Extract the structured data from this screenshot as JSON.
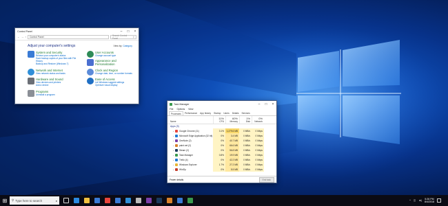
{
  "control_panel": {
    "title": "Control Panel",
    "address": "Control Panel",
    "search_placeholder": "Search Control Panel",
    "heading": "Adjust your computer's settings",
    "view_by_label": "View by:",
    "view_by_value": "Category",
    "categories": [
      {
        "title": "System and Security",
        "links": [
          "Review your computer's status",
          "Save backup copies of your files with File History",
          "Backup and Restore (Windows 7)"
        ],
        "color": "#3a7bd5"
      },
      {
        "title": "Network and Internet",
        "links": [
          "View network status and tasks"
        ],
        "color": "#2f8fd8"
      },
      {
        "title": "Hardware and Sound",
        "links": [
          "View devices and printers",
          "Add a device"
        ],
        "color": "#6b6f76"
      },
      {
        "title": "Programs",
        "links": [
          "Uninstall a program"
        ],
        "color": "#8b8f96"
      },
      {
        "title": "User Accounts",
        "links": [
          "Change account type"
        ],
        "color": "#2e8b57"
      },
      {
        "title": "Appearance and Personalization",
        "links": [],
        "color": "#4a6fd0"
      },
      {
        "title": "Clock and Region",
        "links": [
          "Change date, time, or number formats"
        ],
        "color": "#5b8bd9"
      },
      {
        "title": "Ease of Access",
        "links": [
          "Let Windows suggest settings",
          "Optimize visual display"
        ],
        "color": "#1f6fc4"
      }
    ]
  },
  "task_manager": {
    "title": "Task Manager",
    "menu": [
      "File",
      "Options",
      "View"
    ],
    "tabs": [
      "Processes",
      "Performance",
      "App history",
      "Startup",
      "Users",
      "Details",
      "Services"
    ],
    "columns": {
      "name": "Name",
      "cpu_pct": "11%",
      "cpu": "CPU",
      "mem_pct": "60%",
      "mem": "Memory",
      "disk_pct": "1%",
      "disk": "Disk",
      "net_pct": "0%",
      "net": "Network"
    },
    "group_label": "Apps (9)",
    "rows": [
      {
        "name": "Google Chrome (11)",
        "cpu": "3.1%",
        "mem": "1,279.6 MB",
        "disk": "0 MB/s",
        "net": "0 Mbps",
        "color": "#e8453c"
      },
      {
        "name": "Microsoft Edge Application (32 bit)",
        "cpu": "0%",
        "mem": "3.4 MB",
        "disk": "0 MB/s",
        "net": "0 Mbps",
        "color": "#1e7ad6"
      },
      {
        "name": "OneNote (2)",
        "cpu": "0%",
        "mem": "40.7 MB",
        "disk": "0 MB/s",
        "net": "0 Mbps",
        "color": "#7b3fa8"
      },
      {
        "name": "paint.net (2)",
        "cpu": "0%",
        "mem": "66.6 MB",
        "disk": "0 MB/s",
        "net": "0 Mbps",
        "color": "#d9822b"
      },
      {
        "name": "Steam (2)",
        "cpu": "0%",
        "mem": "56.8 MB",
        "disk": "0 MB/s",
        "net": "0 Mbps",
        "color": "#1b3a5c"
      },
      {
        "name": "Task Manager",
        "cpu": "0.8%",
        "mem": "19.9 MB",
        "disk": "0 MB/s",
        "net": "0 Mbps",
        "color": "#3a9a4e"
      },
      {
        "name": "Trello (4)",
        "cpu": "0%",
        "mem": "42.2 MB",
        "disk": "0 MB/s",
        "net": "0 Mbps",
        "color": "#1e7ad6"
      },
      {
        "name": "Windows Explorer",
        "cpu": "1.7%",
        "mem": "27.2 MB",
        "disk": "0 MB/s",
        "net": "0 Mbps",
        "color": "#e8b534"
      },
      {
        "name": "WinZip",
        "cpu": "0%",
        "mem": "5.5 MB",
        "disk": "0 MB/s",
        "net": "0 Mbps",
        "color": "#c43d2c"
      }
    ],
    "fewer_details": "Fewer details",
    "end_task": "End task"
  },
  "taskbar": {
    "search_placeholder": "Type here to search",
    "apps": [
      {
        "name": "task-view",
        "color": "#ffffff"
      },
      {
        "name": "edge",
        "color": "#2b8ae0"
      },
      {
        "name": "file-explorer",
        "color": "#f0c040"
      },
      {
        "name": "store",
        "color": "#3a7bd5"
      },
      {
        "name": "chrome",
        "color": "#e8453c"
      },
      {
        "name": "mail",
        "color": "#3a7bd5"
      },
      {
        "name": "photos",
        "color": "#2f8fd8"
      },
      {
        "name": "settings",
        "color": "#bbbbbb"
      },
      {
        "name": "onenote",
        "color": "#7b3fa8"
      },
      {
        "name": "steam",
        "color": "#1b3a5c"
      },
      {
        "name": "paint",
        "color": "#d9822b"
      },
      {
        "name": "control-panel",
        "color": "#3a7bd5"
      },
      {
        "name": "task-manager",
        "color": "#3a9a4e"
      }
    ],
    "time": "5:26 PM",
    "date": "8/4/2018"
  }
}
